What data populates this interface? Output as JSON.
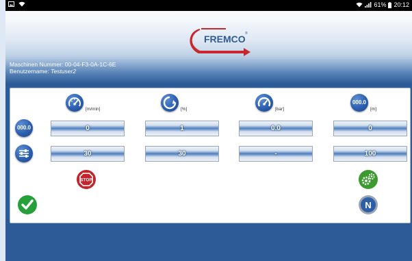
{
  "statusbar": {
    "left_icons": [
      "image-icon",
      "wifi-icon"
    ],
    "right_icons": [
      "wifi-icon",
      "signal-icon",
      "battery-icon"
    ],
    "battery": "61%",
    "time": "20:12"
  },
  "header": {
    "logo_text": "FREMCO",
    "logo_mark": "®"
  },
  "info": {
    "machine_number_label": "Maschinen Nummer:",
    "machine_number_value": "00-04-F3-0A-1C-6E",
    "username_label": "Benutzername:",
    "username_value": "Testuser2"
  },
  "columns": [
    {
      "icon": "speed-gauge-icon",
      "unit": "[m/min]",
      "current": "0",
      "set": "30"
    },
    {
      "icon": "rotation-percent-icon",
      "unit": "[%]",
      "current": "1",
      "set": "30"
    },
    {
      "icon": "pressure-gauge-icon",
      "unit": "[bar]",
      "current": "0.0",
      "set": "-"
    },
    {
      "icon": "distance-counter-icon",
      "icon_text": "000.0",
      "unit": "[m]",
      "current": "0",
      "set": "100"
    }
  ],
  "rows": {
    "current_icon": "counter-icon",
    "current_icon_text": "000.0",
    "set_icon": "settings-sliders-icon"
  },
  "actions": {
    "stop_label": "STOP",
    "neutral_label": "N"
  },
  "colors": {
    "brand_red": "#c8282d",
    "brand_blue": "#2d5b97",
    "stop_red": "#c0262c",
    "check_green": "#26a03a",
    "gear_green": "#3c9b2e"
  }
}
